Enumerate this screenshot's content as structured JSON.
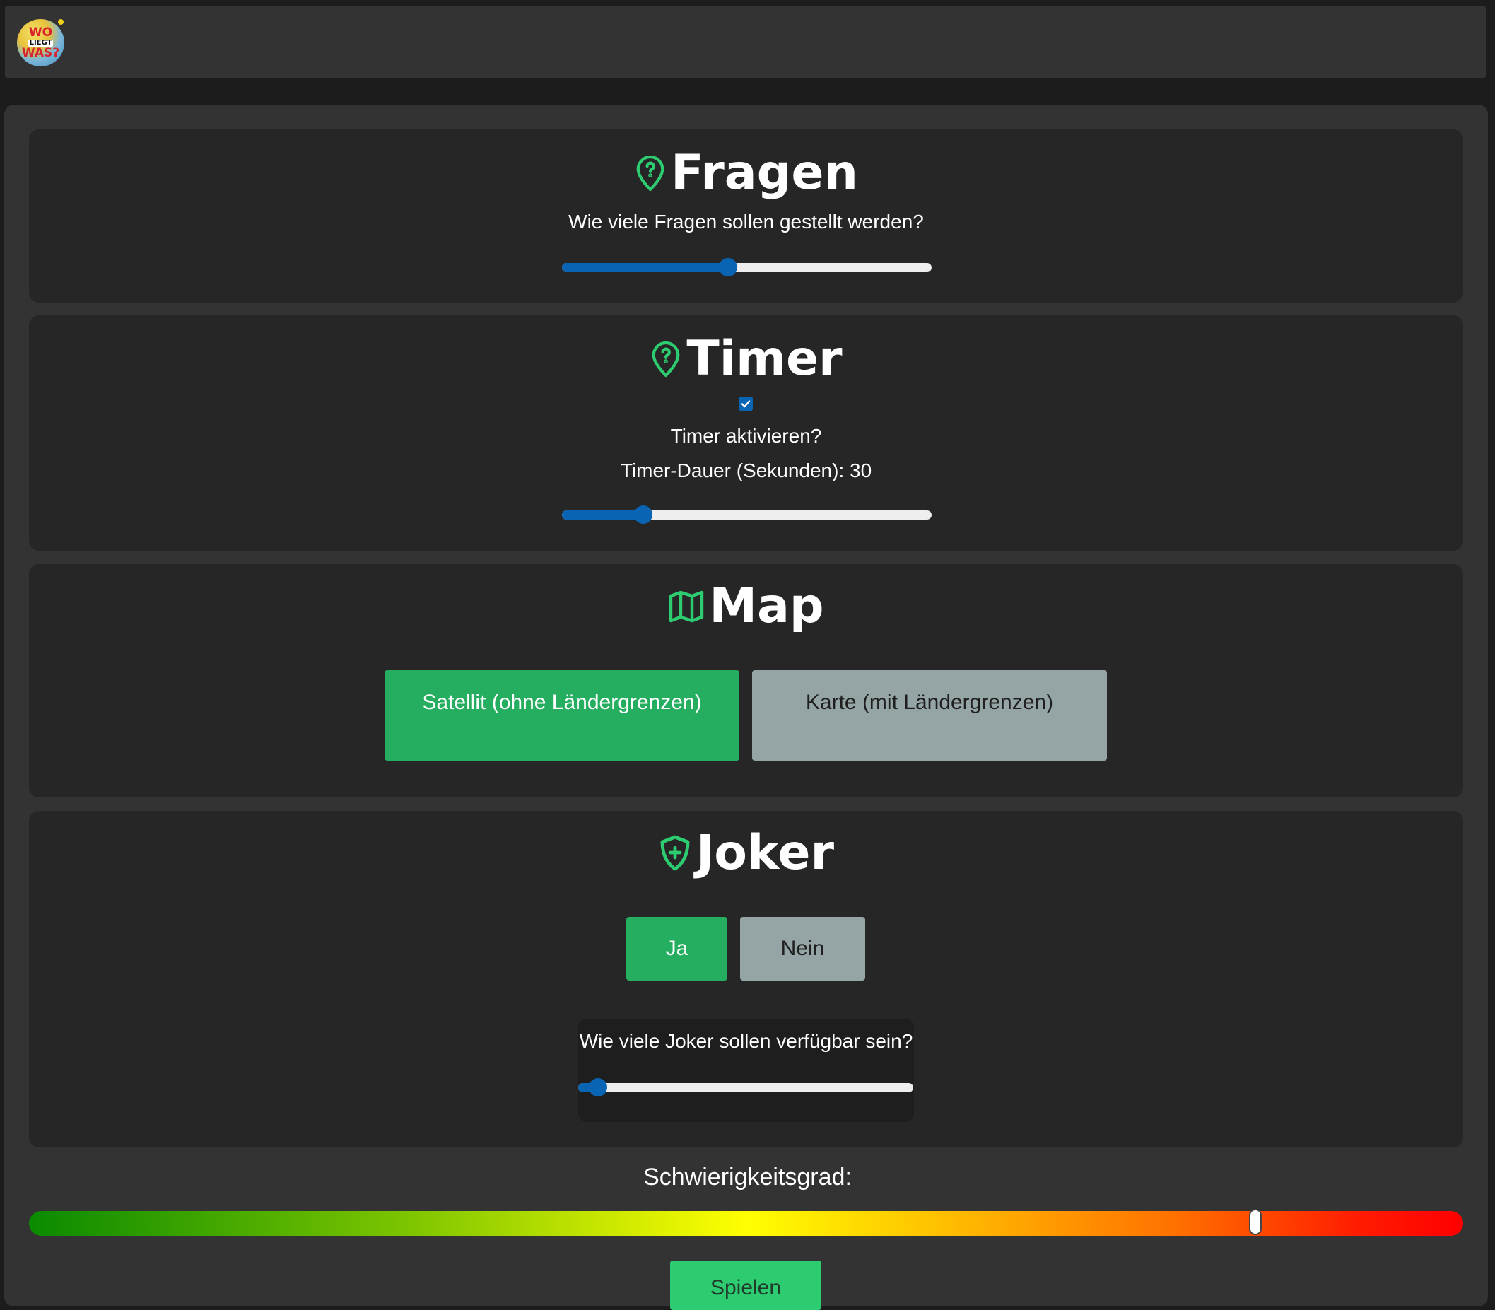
{
  "header": {
    "logo": {
      "line1": "WO",
      "line2": "LIEGT",
      "line3": "WAS?"
    }
  },
  "sections": {
    "fragen": {
      "title": "Fragen",
      "icon": "map-pin-question-icon",
      "question": "Wie viele Fragen sollen gestellt werden?",
      "slider_fraction": 0.45
    },
    "timer": {
      "title": "Timer",
      "icon": "map-pin-question-icon",
      "checkbox_checked": true,
      "checkbox_label": "Timer aktivieren?",
      "duration_label": "Timer-Dauer (Sekunden): 30",
      "slider_fraction": 0.22
    },
    "map": {
      "title": "Map",
      "icon": "map-icon",
      "options": [
        {
          "label": "Satellit (ohne Ländergrenzen)",
          "selected": true
        },
        {
          "label": "Karte (mit Ländergrenzen)",
          "selected": false
        }
      ]
    },
    "joker": {
      "title": "Joker",
      "icon": "shield-plus-icon",
      "options": [
        {
          "label": "Ja",
          "selected": true
        },
        {
          "label": "Nein",
          "selected": false
        }
      ],
      "question": "Wie viele Joker sollen verfügbar sein?",
      "slider_fraction": 0.06
    }
  },
  "difficulty": {
    "label": "Schwierigkeitsgrad:",
    "slider_fraction": 0.855
  },
  "play_button": {
    "label": "Spielen"
  },
  "colors": {
    "accent_green": "#26ae60",
    "slider_blue": "#0a64b4",
    "inactive_gray": "#95a5a6",
    "icon_green": "#2ecc71"
  }
}
